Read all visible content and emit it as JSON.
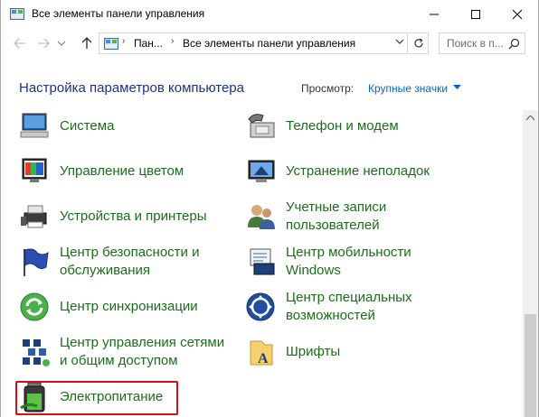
{
  "window": {
    "title": "Все элементы панели управления"
  },
  "nav": {
    "breadcrumb_1": "Пан...",
    "breadcrumb_2": "Все элементы панели управления",
    "search_placeholder": "Поиск в п..."
  },
  "header": {
    "title": "Настройка параметров компьютера",
    "view_label": "Просмотр:",
    "view_value": "Крупные значки"
  },
  "items": [
    {
      "label_1": "Система",
      "label_2": ""
    },
    {
      "label_1": "Телефон и модем",
      "label_2": ""
    },
    {
      "label_1": "Управление цветом",
      "label_2": ""
    },
    {
      "label_1": "Устранение неполадок",
      "label_2": ""
    },
    {
      "label_1": "Устройства и принтеры",
      "label_2": ""
    },
    {
      "label_1": "Учетные записи",
      "label_2": "пользователей"
    },
    {
      "label_1": "Центр безопасности и",
      "label_2": "обслуживания"
    },
    {
      "label_1": "Центр мобильности",
      "label_2": "Windows"
    },
    {
      "label_1": "Центр синхронизации",
      "label_2": ""
    },
    {
      "label_1": "Центр специальных",
      "label_2": "возможностей"
    },
    {
      "label_1": "Центр управления сетями",
      "label_2": "и общим доступом"
    },
    {
      "label_1": "Шрифты",
      "label_2": ""
    },
    {
      "label_1": "Электропитание",
      "label_2": ""
    }
  ],
  "colors": {
    "link_green": "#1a6e1a",
    "title_blue": "#1e3287",
    "highlight_red": "#d0101b"
  }
}
